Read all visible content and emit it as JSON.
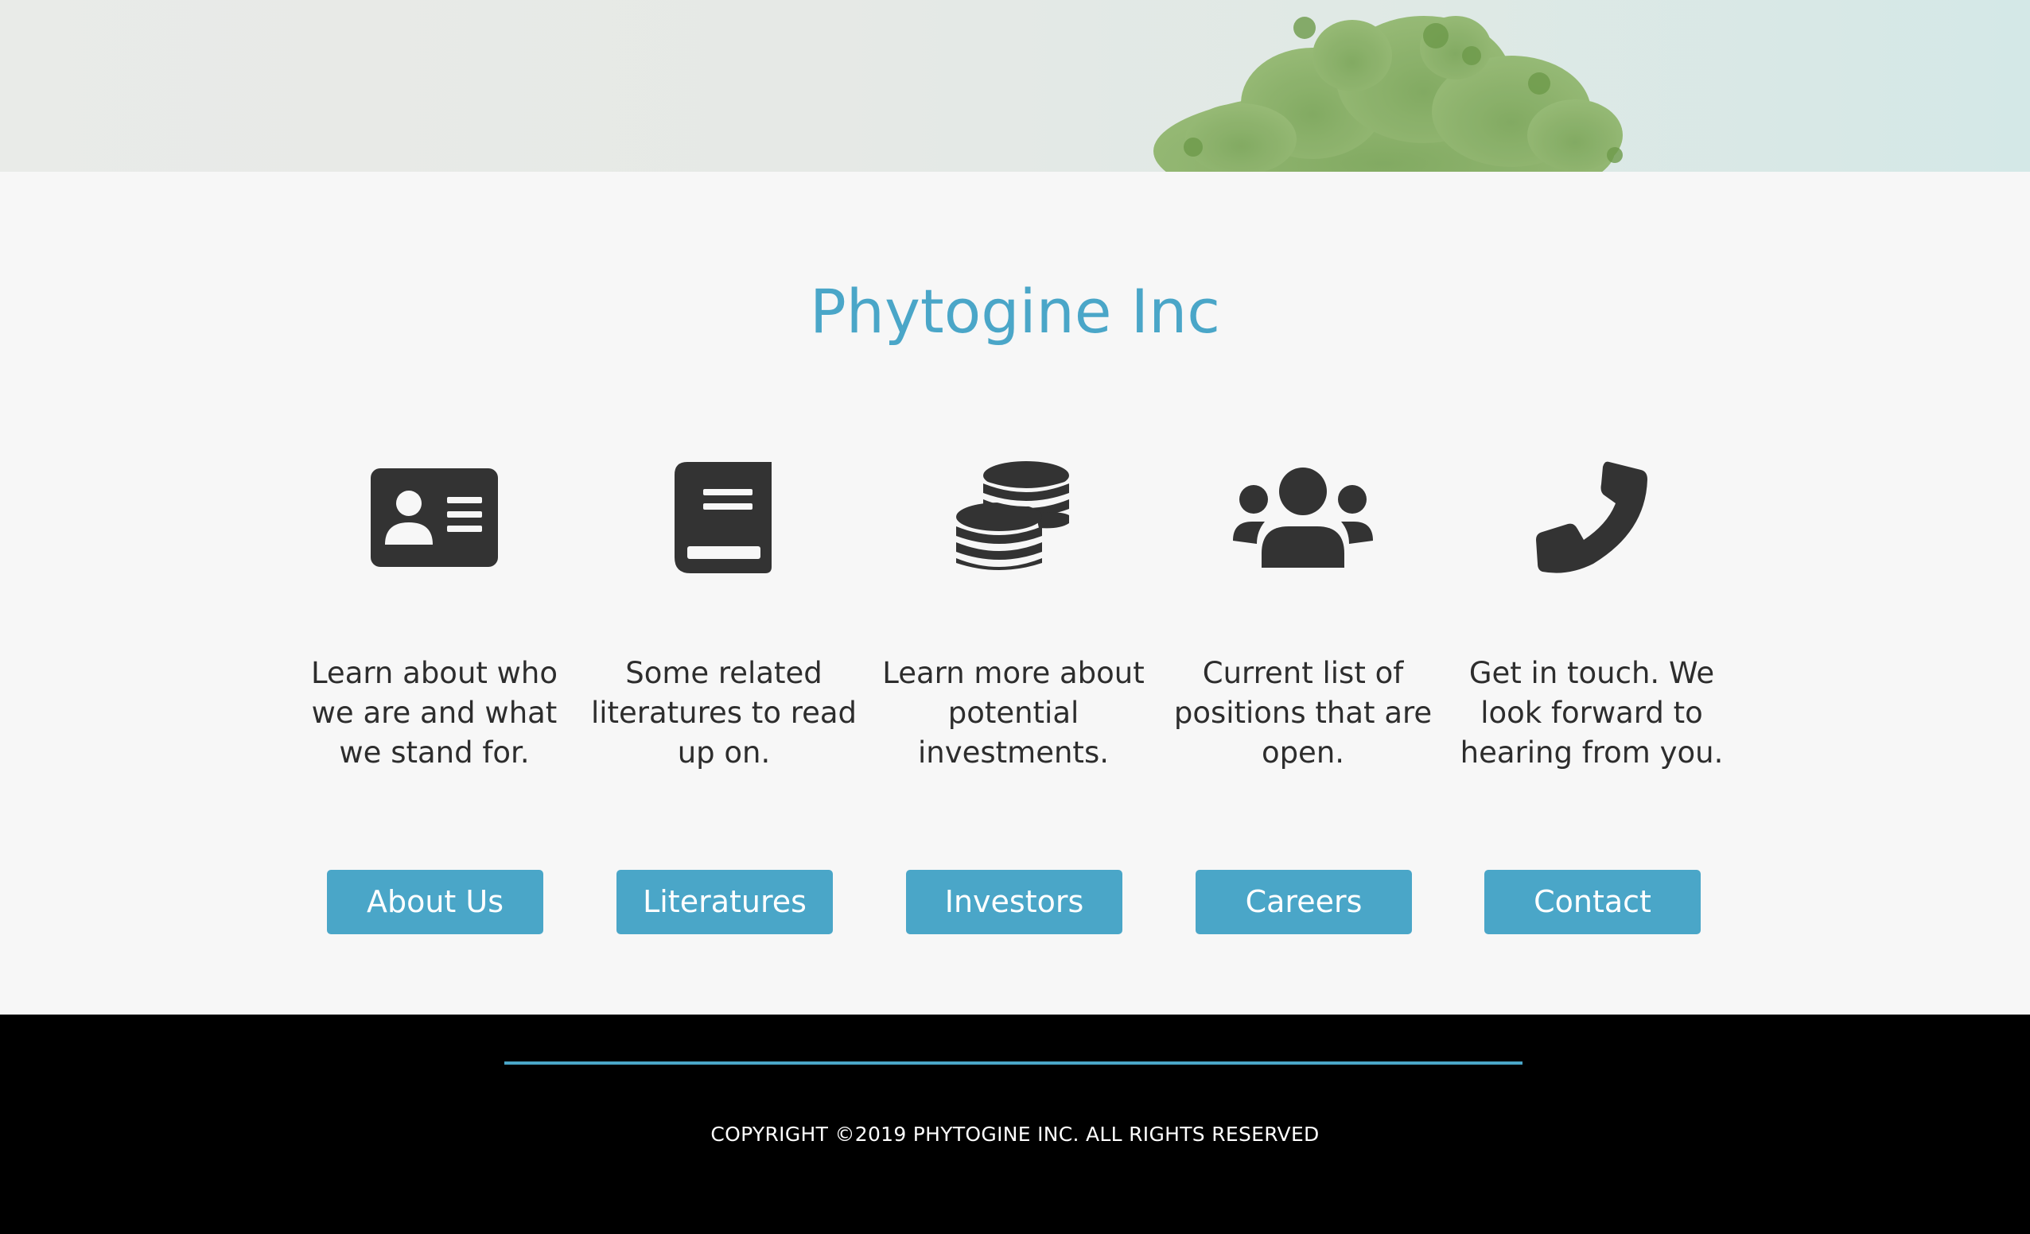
{
  "header": {
    "title": "Phytogine Inc"
  },
  "features": [
    {
      "icon": "id-card-icon",
      "description": "Learn about who we are and what we stand for.",
      "button_label": "About Us"
    },
    {
      "icon": "book-icon",
      "description": "Some related literatures to read up on.",
      "button_label": "Literatures"
    },
    {
      "icon": "coins-icon",
      "description": "Learn more about potential investments.",
      "button_label": "Investors"
    },
    {
      "icon": "users-icon",
      "description": "Current list of positions that are open.",
      "button_label": "Careers"
    },
    {
      "icon": "phone-icon",
      "description": "Get in touch. We look forward to hearing from you.",
      "button_label": "Contact"
    }
  ],
  "footer": {
    "copyright": "COPYRIGHT ©2019 PHYTOGINE INC. ALL RIGHTS RESERVED"
  },
  "colors": {
    "accent": "#4aa6c8",
    "icon": "#333333",
    "footer_bg": "#000000",
    "page_bg": "#f7f7f7"
  }
}
